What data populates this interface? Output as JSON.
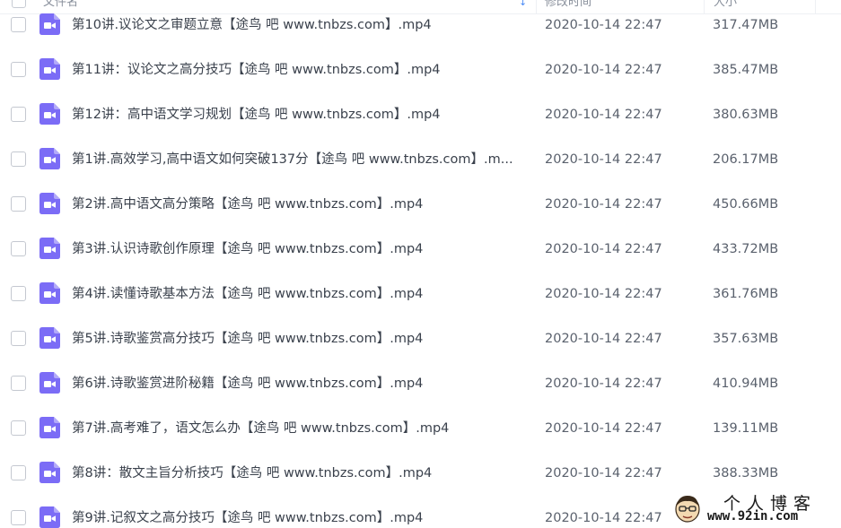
{
  "header": {
    "name_label": "文件名",
    "sort_indicator": "↓",
    "time_label": "修改时间",
    "size_label": "大小"
  },
  "icons": {
    "file_type": "video-file-icon",
    "color": "#7b6cf6"
  },
  "files": [
    {
      "name": "第10讲.议论文之审题立意【途鸟 吧 www.tnbzs.com】.mp4",
      "time": "2020-10-14 22:47",
      "size": "317.47MB"
    },
    {
      "name": "第11讲：议论文之高分技巧【途鸟 吧 www.tnbzs.com】.mp4",
      "time": "2020-10-14 22:47",
      "size": "385.47MB"
    },
    {
      "name": "第12讲：高中语文学习规划【途鸟 吧 www.tnbzs.com】.mp4",
      "time": "2020-10-14 22:47",
      "size": "380.63MB"
    },
    {
      "name": "第1讲.高效学习,高中语文如何突破137分【途鸟 吧 www.tnbzs.com】.m...",
      "time": "2020-10-14 22:47",
      "size": "206.17MB"
    },
    {
      "name": "第2讲.高中语文高分策略【途鸟 吧 www.tnbzs.com】.mp4",
      "time": "2020-10-14 22:47",
      "size": "450.66MB"
    },
    {
      "name": "第3讲.认识诗歌创作原理【途鸟 吧 www.tnbzs.com】.mp4",
      "time": "2020-10-14 22:47",
      "size": "433.72MB"
    },
    {
      "name": "第4讲.读懂诗歌基本方法【途鸟 吧 www.tnbzs.com】.mp4",
      "time": "2020-10-14 22:47",
      "size": "361.76MB"
    },
    {
      "name": "第5讲.诗歌鉴赏高分技巧【途鸟 吧 www.tnbzs.com】.mp4",
      "time": "2020-10-14 22:47",
      "size": "357.63MB"
    },
    {
      "name": "第6讲.诗歌鉴赏进阶秘籍【途鸟 吧 www.tnbzs.com】.mp4",
      "time": "2020-10-14 22:47",
      "size": "410.94MB"
    },
    {
      "name": "第7讲.高考难了，语文怎么办【途鸟 吧 www.tnbzs.com】.mp4",
      "time": "2020-10-14 22:47",
      "size": "139.11MB"
    },
    {
      "name": "第8讲：散文主旨分析技巧【途鸟 吧 www.tnbzs.com】.mp4",
      "time": "2020-10-14 22:47",
      "size": "388.33MB"
    },
    {
      "name": "第9讲.记叙文之高分技巧【途鸟 吧 www.tnbzs.com】.mp4",
      "time": "2020-10-14 22:47",
      "size": ""
    }
  ],
  "watermark": {
    "title": "个人博客",
    "url": "www.92in.com"
  }
}
